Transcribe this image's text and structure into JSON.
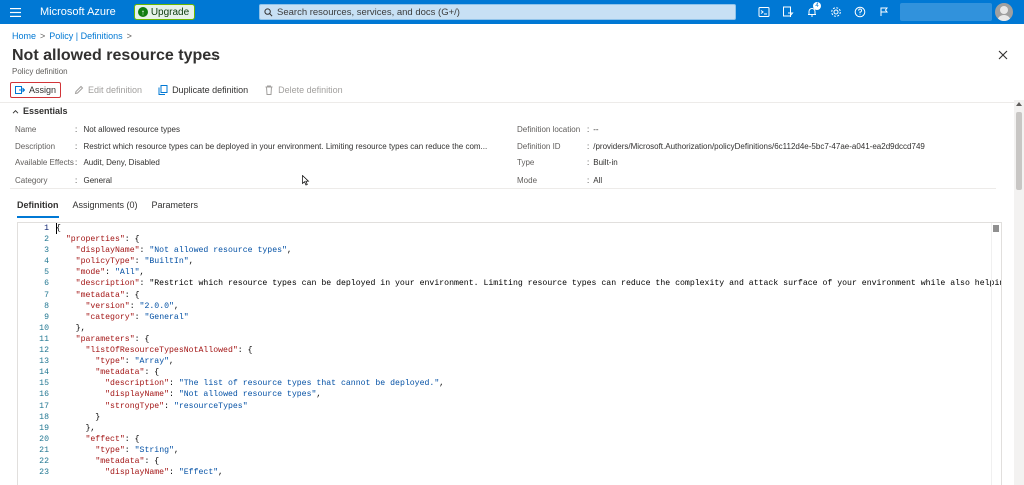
{
  "topbar": {
    "brand": "Microsoft Azure",
    "upgrade_label": "Upgrade",
    "search_placeholder": "Search resources, services, and docs (G+/)",
    "notification_count": "4",
    "bg_color": "#0078d4"
  },
  "breadcrumb": {
    "home": "Home",
    "sep1": ">",
    "policy": "Policy | Definitions",
    "sep2": ">"
  },
  "page": {
    "title": "Not allowed resource types",
    "more": "...",
    "subtitle": "Policy definition"
  },
  "toolbar": {
    "assign": "Assign",
    "edit": "Edit definition",
    "duplicate": "Duplicate definition",
    "delete": "Delete definition"
  },
  "essentials": {
    "header": "Essentials",
    "left": [
      {
        "key": "Name",
        "value": "Not allowed resource types"
      },
      {
        "key": "Description",
        "value": "Restrict which resource types can be deployed in your environment. Limiting resource types can reduce the com..."
      },
      {
        "key": "Available Effects",
        "value": "Audit, Deny, Disabled"
      },
      {
        "key": "Category",
        "value": "General"
      }
    ],
    "right": [
      {
        "key": "Definition location",
        "value": "--"
      },
      {
        "key": "Definition ID",
        "value": "/providers/Microsoft.Authorization/policyDefinitions/6c112d4e-5bc7-47ae-a041-ea2d9dccd749"
      },
      {
        "key": "Type",
        "value": "Built-in"
      },
      {
        "key": "Mode",
        "value": "All"
      }
    ]
  },
  "tabs": [
    {
      "label": "Definition",
      "active": true
    },
    {
      "label": "Assignments (0)",
      "active": false
    },
    {
      "label": "Parameters",
      "active": false
    }
  ],
  "editor": {
    "line_numbers": [
      "1",
      "2",
      "3",
      "4",
      "5",
      "6",
      "7",
      "8",
      "9",
      "10",
      "11",
      "12",
      "13",
      "14",
      "15",
      "16",
      "17",
      "18",
      "19",
      "20",
      "21",
      "22",
      "23"
    ],
    "lines": [
      "{",
      "  \"properties\": {",
      "    \"displayName\": \"Not allowed resource types\",",
      "    \"policyType\": \"BuiltIn\",",
      "    \"mode\": \"All\",",
      "    \"description\": \"Restrict which resource types can be deployed in your environment. Limiting resource types can reduce the complexity and attack surface of your environment while also helping to manage",
      "    \"metadata\": {",
      "      \"version\": \"2.0.0\",",
      "      \"category\": \"General\"",
      "    },",
      "    \"parameters\": {",
      "      \"listOfResourceTypesNotAllowed\": {",
      "        \"type\": \"Array\",",
      "        \"metadata\": {",
      "          \"description\": \"The list of resource types that cannot be deployed.\",",
      "          \"displayName\": \"Not allowed resource types\",",
      "          \"strongType\": \"resourceTypes\"",
      "        }",
      "      },",
      "      \"effect\": {",
      "        \"type\": \"String\",",
      "        \"metadata\": {",
      "          \"displayName\": \"Effect\","
    ]
  }
}
